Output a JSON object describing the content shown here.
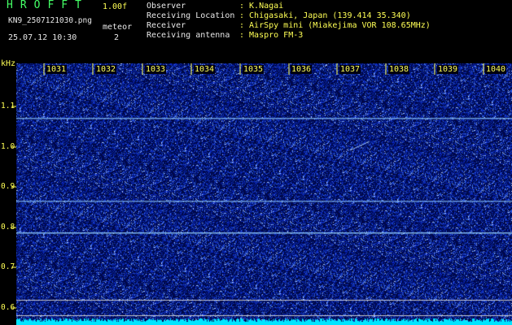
{
  "header": {
    "app_title": "HROFFT",
    "version": "1.00f",
    "filename": "KN9_2507121030.png",
    "datetime": "25.07.12 10:30",
    "meteor_label": "meteor",
    "meteor_count": "2"
  },
  "info": [
    {
      "key": "Observer",
      "value": ": K.Nagai"
    },
    {
      "key": "Receiving Location",
      "value": ": Chigasaki, Japan (139.414 35.340)"
    },
    {
      "key": "Receiver",
      "value": ": AirSpy mini (Miakejima VOR 108.65MHz)"
    },
    {
      "key": "Receiving antenna",
      "value": ": Maspro FM-3"
    }
  ],
  "axis": {
    "unit": "kHz",
    "x_ticks": [
      "1031",
      "1032",
      "1033",
      "1034",
      "1035",
      "1036",
      "1037",
      "1038",
      "1039",
      "1040"
    ],
    "y_ticks": [
      "1.1",
      "1.0",
      "0.9",
      "0.8",
      "0.7",
      "0.6"
    ]
  },
  "colors": {
    "background": "#000000",
    "waterfall_bg": "#000a4a",
    "signal": "#8ec8ff",
    "noise_floor": "#00e5ff",
    "label_yellow": "#ffff55",
    "title_green": "#44ff66"
  }
}
